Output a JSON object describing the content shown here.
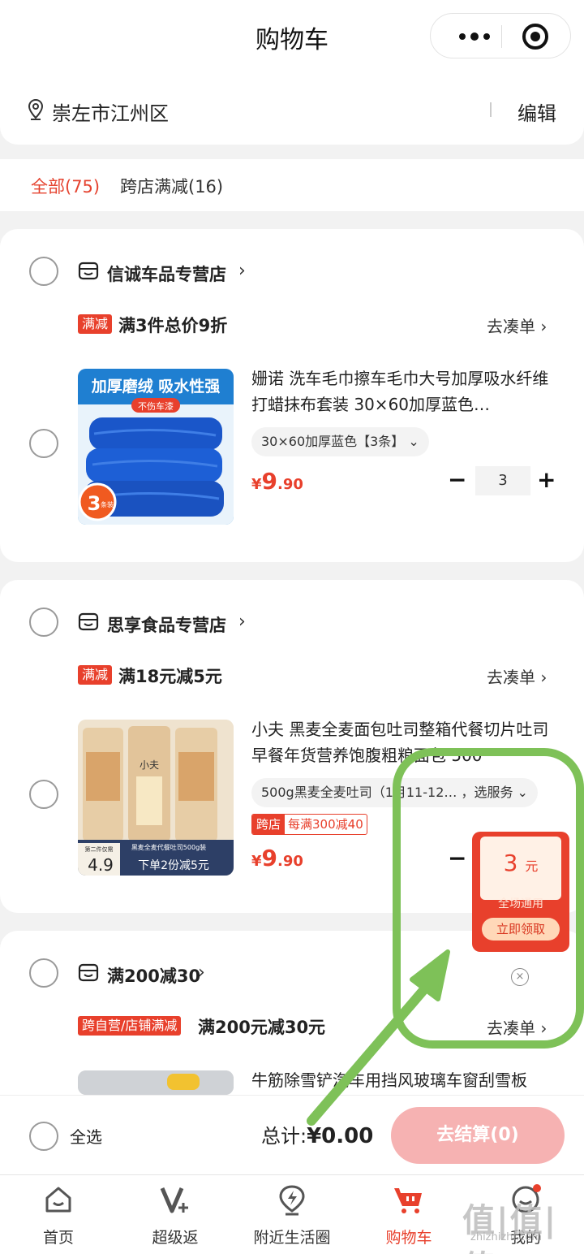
{
  "header": {
    "title": "购物车"
  },
  "address": {
    "text": "崇左市江州区",
    "edit_label": "编辑"
  },
  "filters": {
    "all": "全部(75)",
    "cross_store": "跨店满减(16)"
  },
  "stores": [
    {
      "name": "信诚车品专营店",
      "promo_tag": "满减",
      "promo_text": "满3件总价9折",
      "go_collect": "去凑单 ›",
      "product": {
        "title": "姗诺 洗车毛巾擦车毛巾大号加厚吸水纤维打蜡抹布套装 30×60加厚蓝色…",
        "thumb_top": "加厚磨绒 吸水性强",
        "thumb_sub": "不伤车漆",
        "thumb_badge": "3",
        "thumb_badge_unit": "条装",
        "sku": "30×60加厚蓝色【3条】 ⌄",
        "price_currency": "¥",
        "price_int": "9",
        "price_dec": ".90",
        "qty": "3"
      }
    },
    {
      "name": "思享食品专营店",
      "promo_tag": "满减",
      "promo_text": "满18元减5元",
      "go_collect": "去凑单 ›",
      "product": {
        "title": "小夫 黑麦全麦面包吐司整箱代餐切片吐司早餐年货营养饱腹粗粮面包 500",
        "thumb_brand": "小夫",
        "thumb_price": "4.9",
        "thumb_price_label": "第二件仅需",
        "thumb_caption": "黑麦全麦代餐吐司500g装",
        "thumb_banner": "下单2份减5元",
        "sku": "500g黑麦全麦吐司（1月11-12… ，选服务 ⌄",
        "cross_tag_a": "跨店",
        "cross_tag_b": "每满300减40",
        "price_currency": "¥",
        "price_int": "9",
        "price_dec": ".90"
      }
    },
    {
      "name": "满200减30",
      "promo_tag": "跨自营/店铺满减",
      "promo_text": "满200元减30元",
      "go_collect": "去凑单 ›",
      "product": {
        "title": "牛筋除雪铲汽车用挡风玻璃车窗刮雪板"
      }
    }
  ],
  "coupon_popup": {
    "amount": "3",
    "unit": "元",
    "scope": "全场通用",
    "claim_label": "立即领取",
    "close": "×"
  },
  "bottom": {
    "select_all": "全选",
    "total_label": "总计:",
    "total_value": "¥0.00",
    "checkout": "去结算(0)"
  },
  "tabs": [
    {
      "label": "首页",
      "icon": "home-icon"
    },
    {
      "label": "超级返",
      "icon": "vplus-icon"
    },
    {
      "label": "附近生活圈",
      "icon": "lightning-pin-icon"
    },
    {
      "label": "购物车",
      "icon": "cart-icon",
      "active": true
    },
    {
      "label": "我的",
      "icon": "profile-icon"
    }
  ],
  "watermark": {
    "main": "值|值|值",
    "sub": "zhizhizhi.com"
  },
  "colors": {
    "accent": "#e8402c",
    "annotation": "#7ec158",
    "checkout_disabled": "#f6b2b2"
  }
}
